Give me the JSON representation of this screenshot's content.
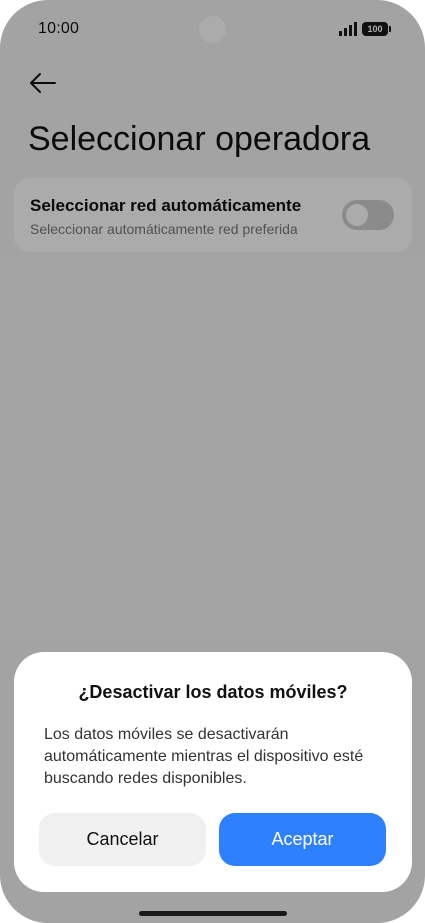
{
  "status_bar": {
    "time": "10:00",
    "battery": "100"
  },
  "header": {
    "title": "Seleccionar operadora"
  },
  "settings": {
    "auto_network": {
      "title": "Seleccionar red automáticamente",
      "subtitle": "Seleccionar automáticamente red preferida",
      "enabled": false
    }
  },
  "dialog": {
    "title": "¿Desactivar los datos móviles?",
    "message": "Los datos móviles se desactivarán automáticamente mientras el dispositivo esté buscando redes disponibles.",
    "cancel_label": "Cancelar",
    "accept_label": "Aceptar"
  },
  "colors": {
    "accent": "#2f80ff",
    "overlay": "rgba(0,0,0,0.33)"
  }
}
